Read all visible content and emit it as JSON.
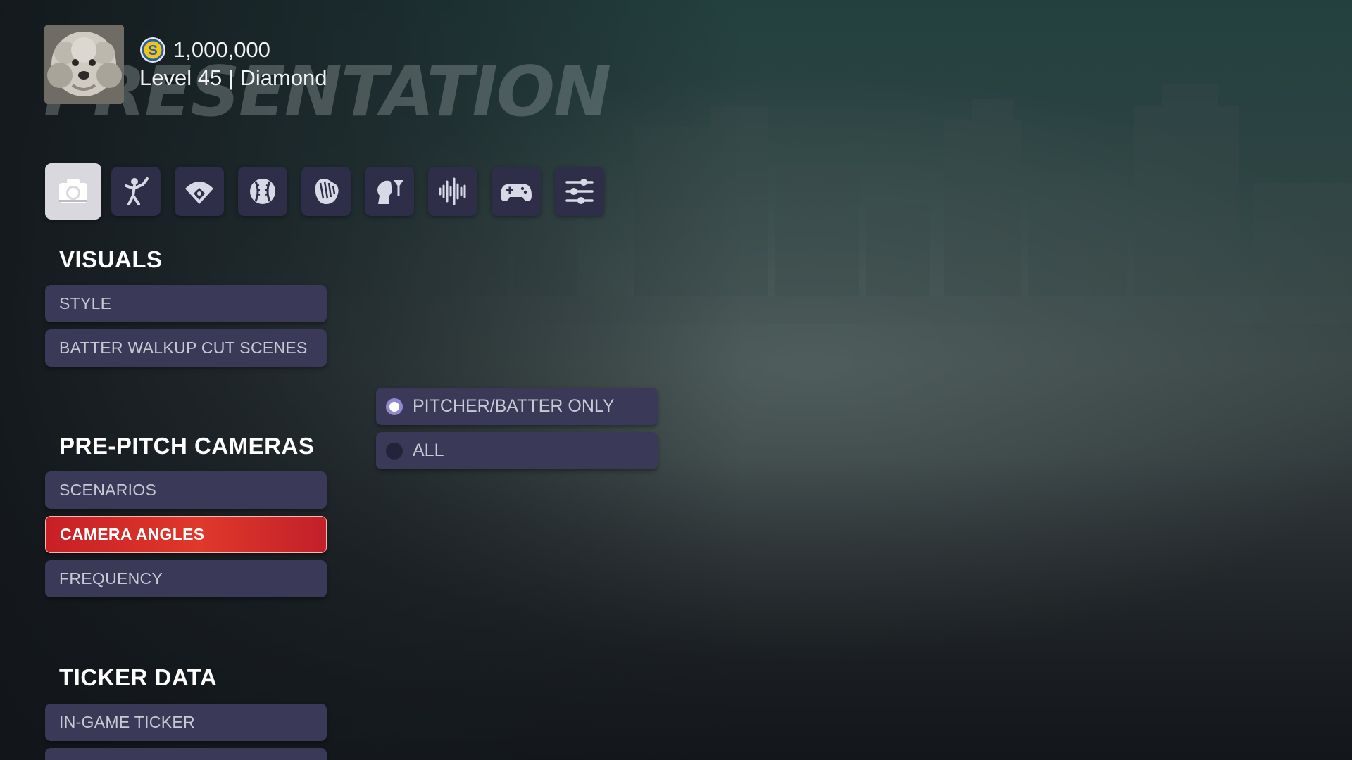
{
  "page": {
    "background_title": "PRESENTATION"
  },
  "profile": {
    "avatar": "profile-avatar-dog",
    "coin_icon": "stubs-coin-icon",
    "coins": "1,000,000",
    "level_text": "Level 45 | Diamond"
  },
  "tabs": [
    {
      "icon": "camera-icon",
      "active": true
    },
    {
      "icon": "batter-swing-icon",
      "active": false
    },
    {
      "icon": "baseball-field-icon",
      "active": false
    },
    {
      "icon": "baseball-icon",
      "active": false
    },
    {
      "icon": "fielding-glove-icon",
      "active": false
    },
    {
      "icon": "commentary-head-icon",
      "active": false
    },
    {
      "icon": "audio-waveform-icon",
      "active": false
    },
    {
      "icon": "gamepad-icon",
      "active": false
    },
    {
      "icon": "sliders-icon",
      "active": false
    }
  ],
  "sections": {
    "visuals": {
      "heading": "VISUALS",
      "items": [
        "STYLE",
        "BATTER WALKUP CUT SCENES"
      ]
    },
    "pre_pitch": {
      "heading": "PRE-PITCH CAMERAS",
      "items": [
        "SCENARIOS",
        "CAMERA ANGLES",
        "FREQUENCY"
      ],
      "selected": "CAMERA ANGLES"
    },
    "ticker": {
      "heading": "TICKER DATA",
      "items": [
        "IN-GAME TICKER",
        ""
      ]
    }
  },
  "options": {
    "items": [
      "PITCHER/BATTER ONLY",
      "ALL"
    ],
    "selected": "PITCHER/BATTER ONLY"
  },
  "colors": {
    "accent_selected": "#d42a28",
    "menu_item_bg": "#3a3957",
    "radio_on": "#8f8ad0"
  }
}
